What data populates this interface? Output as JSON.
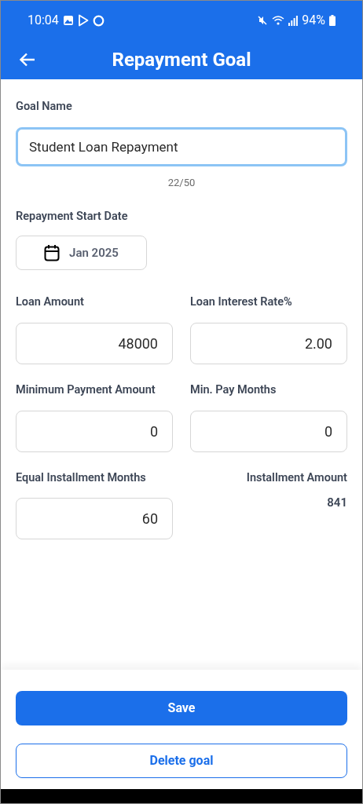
{
  "status_bar": {
    "time": "10:04",
    "battery": "94%"
  },
  "app_bar": {
    "title": "Repayment Goal"
  },
  "goal_name": {
    "label": "Goal Name",
    "value": "Student Loan Repayment",
    "focused": true,
    "counter": "22/50"
  },
  "start_date": {
    "label": "Repayment Start Date",
    "value": "Jan 2025"
  },
  "fields": [
    {
      "kind": "input",
      "label": "Loan Amount",
      "value": "48000"
    },
    {
      "kind": "input",
      "label": "Loan Interest Rate%",
      "value": "2.00"
    },
    {
      "kind": "input",
      "label": "Minimum Payment Amount",
      "value": "0"
    },
    {
      "kind": "input",
      "label": "Min. Pay Months",
      "value": "0"
    },
    {
      "kind": "input",
      "label": "Equal Installment Months",
      "value": "60"
    },
    {
      "kind": "readout",
      "label": "Installment Amount",
      "value": "841"
    }
  ],
  "buttons": [
    {
      "kind": "primary",
      "label": "Save"
    },
    {
      "kind": "outline",
      "label": "Delete goal"
    }
  ]
}
